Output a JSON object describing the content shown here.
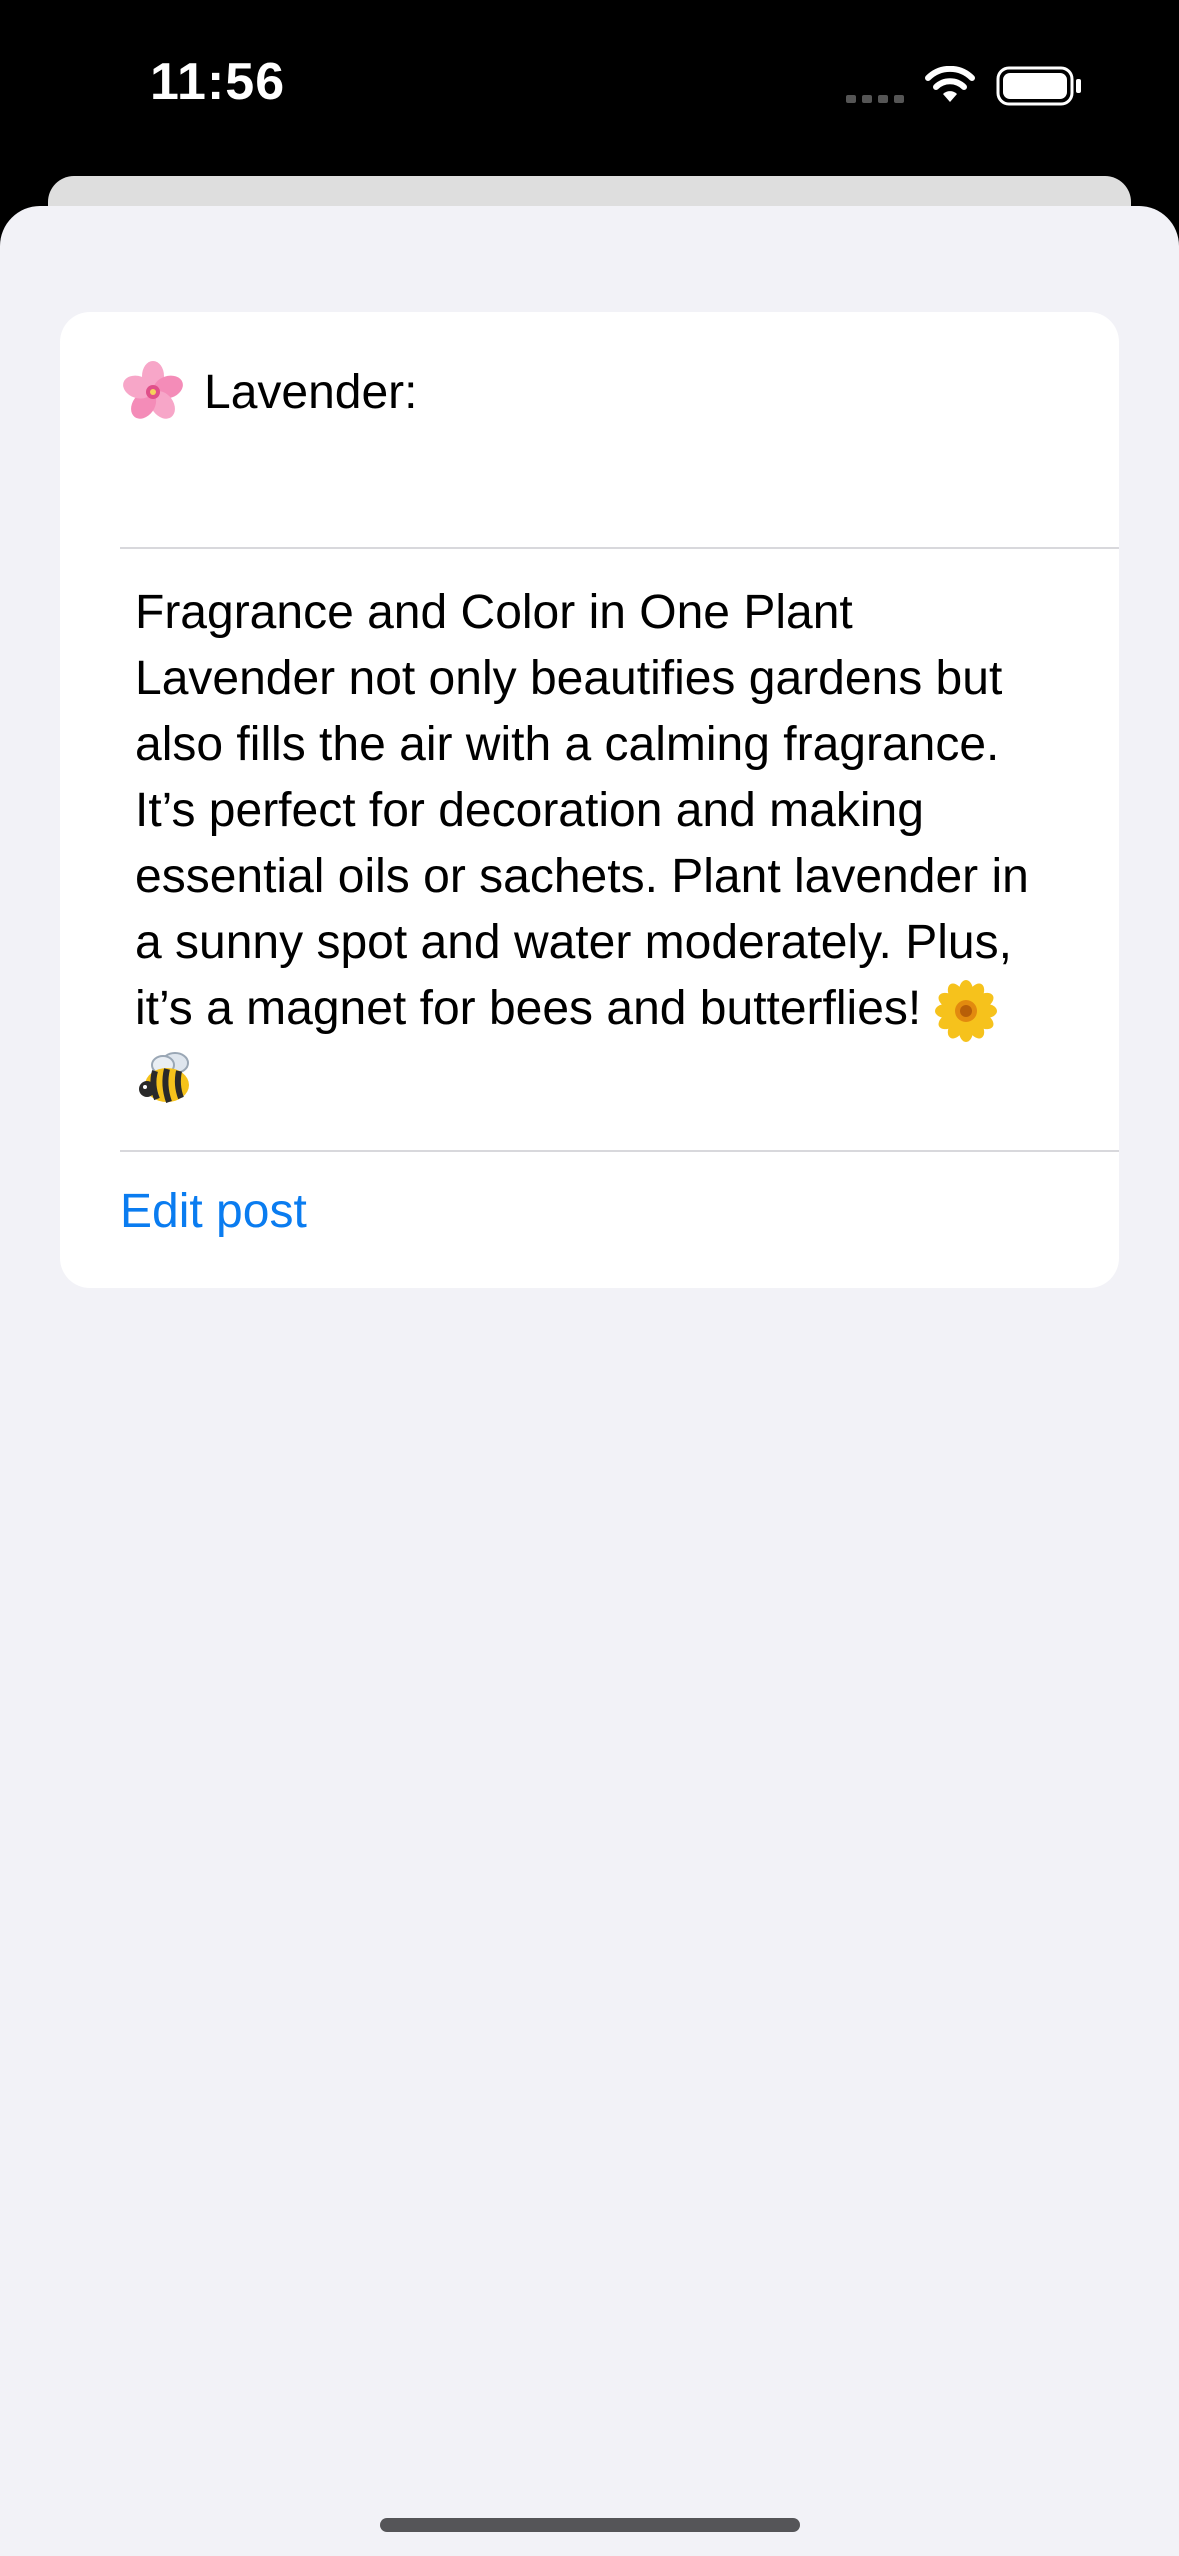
{
  "status_bar": {
    "time": "11:56"
  },
  "post": {
    "title_icon": "cherry-blossom-icon",
    "title": "Lavender:",
    "body": "Fragrance and Color in One Plant Lavender not only beautifies gardens but also fills the air with a calming fragrance. It’s perfect for decoration and making essential oils or sachets. Plant lavender in a sunny spot and water moderately. Plus, it’s a magnet for bees and butterflies!",
    "body_emojis": [
      "sunflower-icon",
      "bee-icon"
    ]
  },
  "actions": {
    "edit_label": "Edit post"
  },
  "colors": {
    "accent": "#0a7cf0",
    "background": "#f2f2f7",
    "card": "#ffffff"
  }
}
